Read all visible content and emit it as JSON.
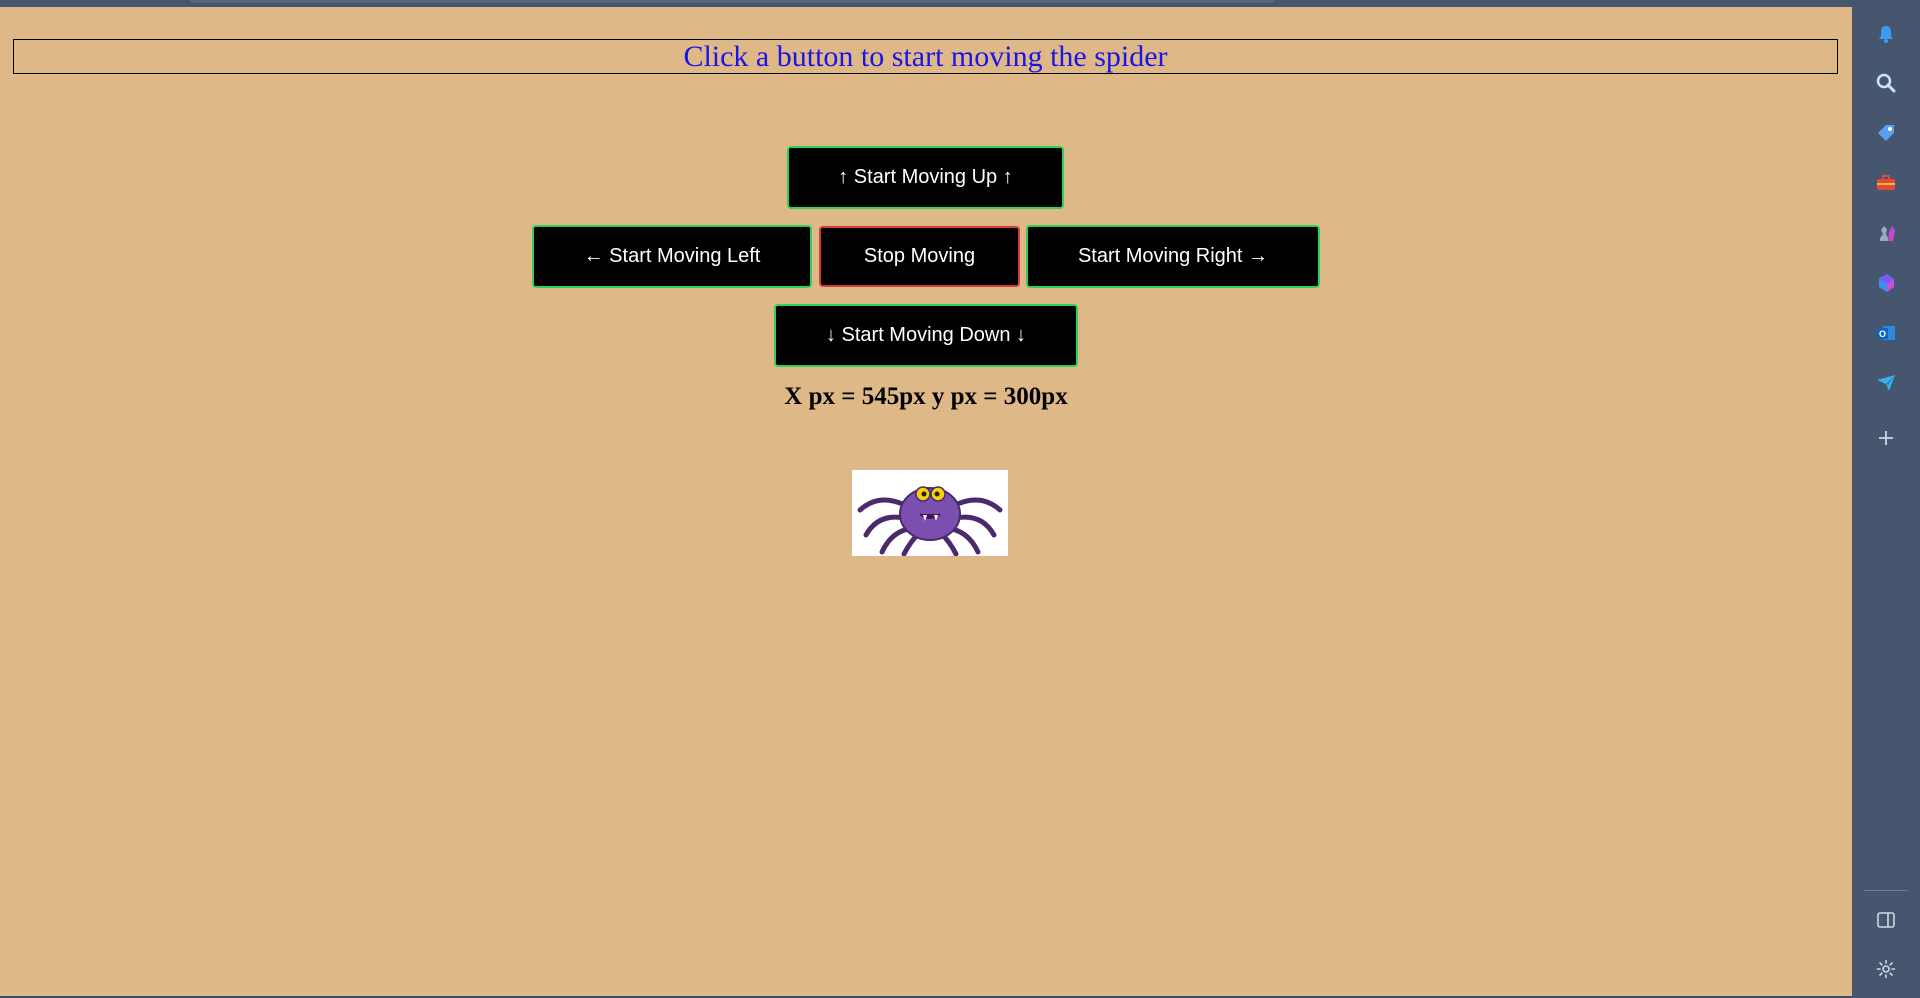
{
  "page": {
    "heading": "Click a button to start moving the spider",
    "coords_text": "X px = 545px y px = 300px"
  },
  "buttons": {
    "up": "↑ Start Moving Up ↑",
    "left": "← Start Moving Left",
    "stop": "Stop Moving",
    "right": "Start Moving Right →",
    "down": "↓ Start Moving Down ↓"
  },
  "spider": {
    "icon": "spider-image"
  },
  "sidebar": {
    "icons": [
      "bell-icon",
      "search-icon",
      "tag-icon",
      "toolbox-icon",
      "chess-icon",
      "copilot-icon",
      "outlook-icon",
      "paper-plane-icon",
      "plus-icon",
      "panel-icon",
      "gear-icon"
    ]
  },
  "colors": {
    "page_bg": "#deb887",
    "heading_text": "#1a14e6",
    "button_bg": "#000000",
    "button_border": "#2fd05a",
    "stop_border": "#d43b3b",
    "sidebar_bg": "#45566e"
  }
}
